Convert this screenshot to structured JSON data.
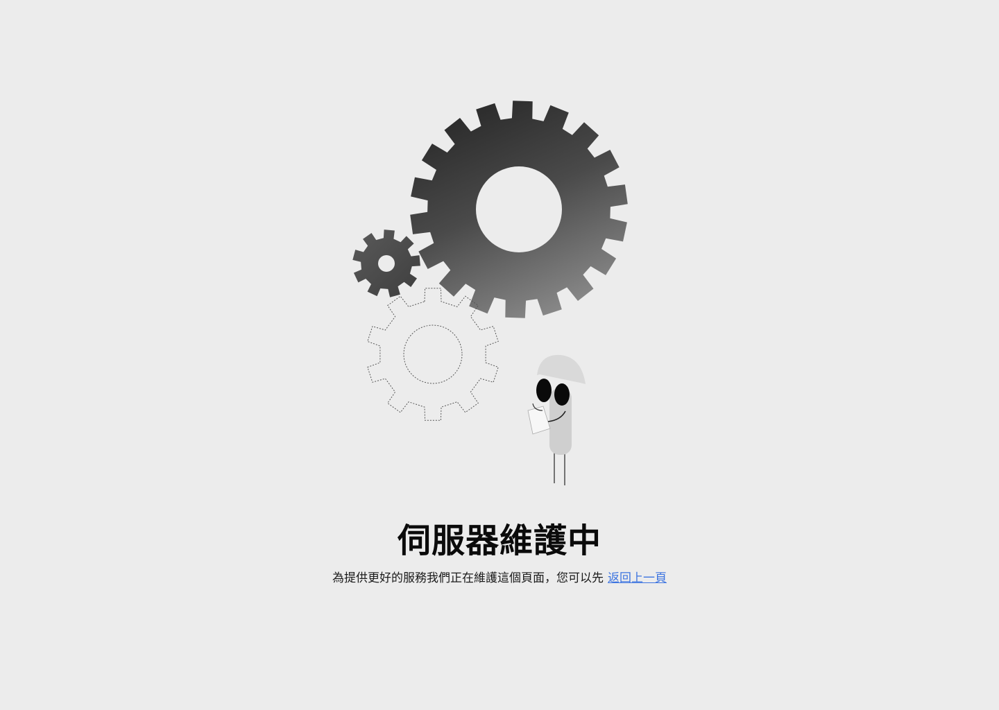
{
  "maintenance": {
    "title": "伺服器維護中",
    "message": "為提供更好的服務我們正在維護這個頁面，您可以先",
    "back_link": "返回上一頁"
  },
  "colors": {
    "background": "#ececec",
    "gear_dark": "#2b2b2b",
    "gear_light": "#8a8a8a",
    "link": "#3b73e0",
    "character_body": "#cfcfcf",
    "helmet": "#d9d9d9"
  },
  "icons": [
    "large-gear-icon",
    "small-gear-icon",
    "outline-gear-icon",
    "worker-character"
  ]
}
